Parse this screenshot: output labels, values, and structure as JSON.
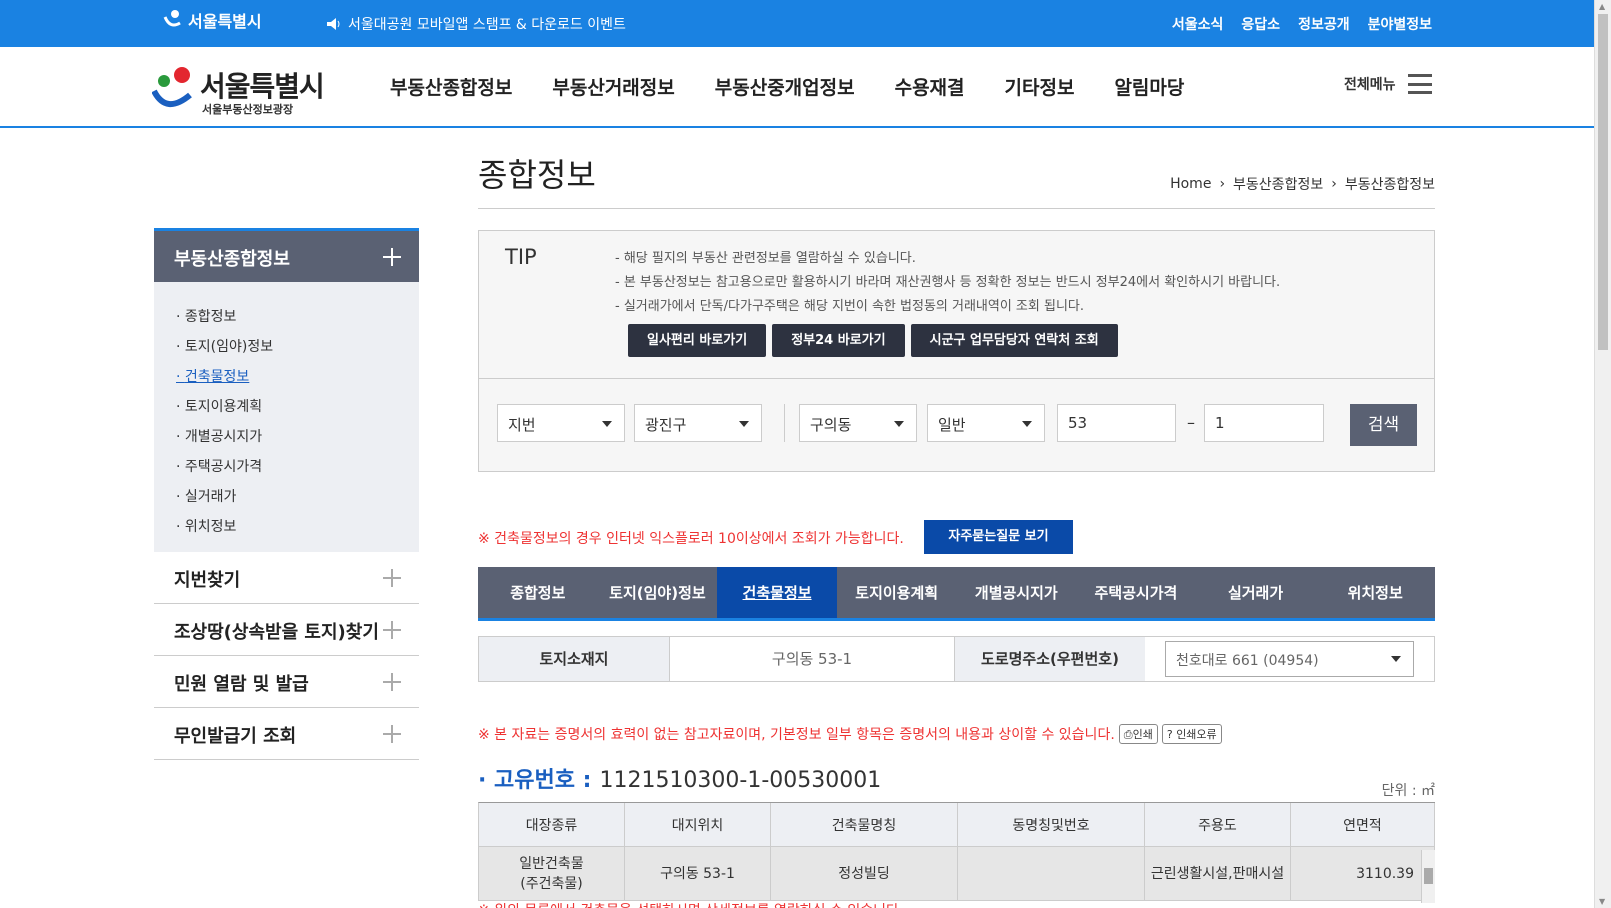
{
  "topbar": {
    "city_logo": "서울특별시",
    "notice": "서울대공원 모바일앱 스탬프 & 다운로드 이벤트",
    "links": [
      "서울소식",
      "응답소",
      "정보공개",
      "분야별정보"
    ]
  },
  "header": {
    "brand_name": "서울특별시",
    "brand_sub": "서울부동산정보광장",
    "gnb": [
      "부동산종합정보",
      "부동산거래정보",
      "부동산중개업정보",
      "수용재결",
      "기타정보",
      "알림마당"
    ],
    "all_menu": "전체메뉴"
  },
  "lnb": {
    "head": "부동산종합정보",
    "sub": [
      "종합정보",
      "토지(임야)정보",
      "건축물정보",
      "토지이용계획",
      "개별공시지가",
      "주택공시가격",
      "실거래가",
      "위치정보"
    ],
    "active_index": 2,
    "items": [
      "지번찾기",
      "조상땅(상속받을 토지)찾기",
      "민원 열람 및 발급",
      "무인발급기 조회"
    ]
  },
  "content": {
    "title": "종합정보",
    "breadcrumb": [
      "Home",
      "부동산종합정보",
      "부동산종합정보"
    ],
    "tip": {
      "label": "TIP",
      "lines": [
        "해당 필지의 부동산 관련정보를 열람하실 수 있습니다.",
        "본 부동산정보는 참고용으로만 활용하시기 바라며 재산권행사 등 정확한 정보는 반드시 정부24에서 확인하시기 바랍니다.",
        "실거래가에서 단독/다가구주택은 해당 지번이 속한 법정동의 거래내역이 조회 됩니다."
      ],
      "buttons": [
        "일사편리 바로가기",
        "정부24 바로가기",
        "시군구 업무담당자 연락처 조회"
      ]
    },
    "search": {
      "type": "지번",
      "gu": "광진구",
      "dong": "구의동",
      "kind": "일반",
      "bon": "53",
      "dash": "–",
      "bu": "1",
      "button": "검색"
    },
    "warn1": "※ 건축물정보의 경우 인터넷 익스플로러 10이상에서 조회가 가능합니다.",
    "faq_button": "자주묻는질문 보기",
    "tabs": [
      "종합정보",
      "토지(임야)정보",
      "건축물정보",
      "토지이용계획",
      "개별공시지가",
      "주택공시가격",
      "실거래가",
      "위치정보"
    ],
    "active_tab": 2,
    "addr": {
      "land_label": "토지소재지",
      "land_value": "구의동 53-1",
      "road_label": "도로명주소(우편번호)",
      "road_value": "천호대로 661 (04954)"
    },
    "warn2": "※ 본 자료는 증명서의 효력이 없는 참고자료이며, 기본정보 일부 항목은 증명서의 내용과 상이할 수 있습니다.",
    "print_button": "인쇄",
    "print_error_button": "인쇄오류",
    "uid_label": "고유번호 :",
    "uid_value": "1121510300-1-00530001",
    "unit": "단위 : ㎡",
    "table": {
      "headers": [
        "대장종류",
        "대지위치",
        "건축물명칭",
        "동명칭및번호",
        "주용도",
        "연면적"
      ],
      "rows": [
        [
          "일반건축물\n(주건축물)",
          "구의동 53-1",
          "정성빌딩",
          "",
          "근린생활시설,판매시설",
          "3110.39"
        ]
      ]
    },
    "warn3": "※ 위의 목록에서 건축물을 선택하시면 상세정보를 열람하실 수 있습니다."
  },
  "colors": {
    "brand_blue": "#1a82e2",
    "nav_dark": "#5a6173",
    "active_blue": "#0a4aa8",
    "warning_red": "#e33333"
  }
}
